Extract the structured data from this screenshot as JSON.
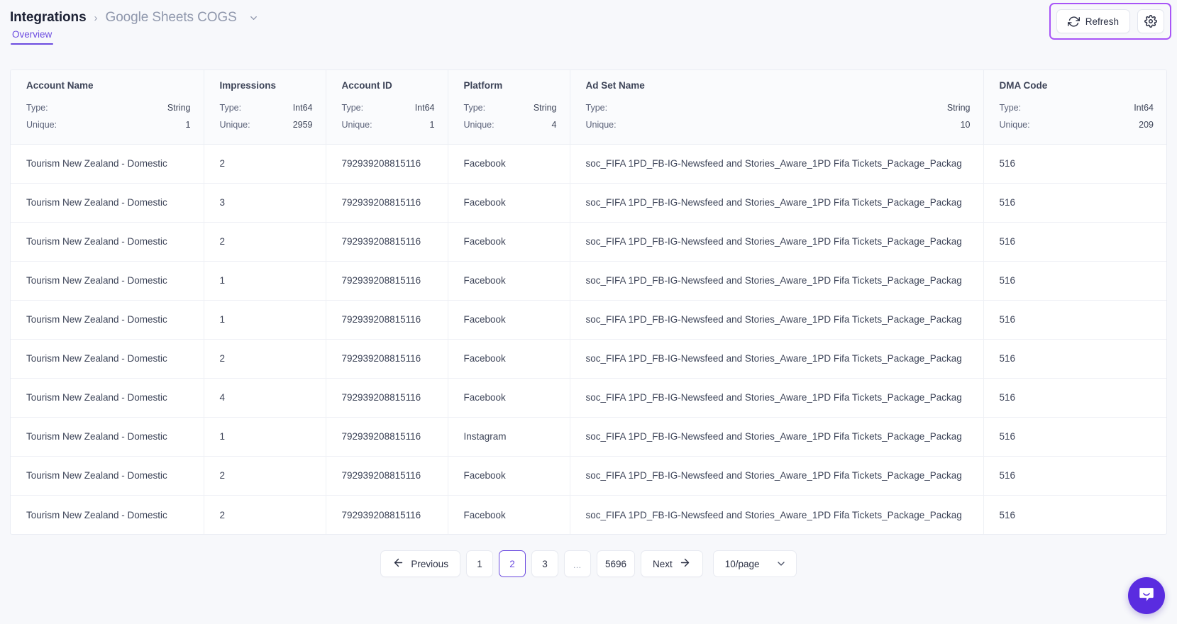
{
  "header": {
    "breadcrumb_root": "Integrations",
    "breadcrumb_separator": "›",
    "breadcrumb_current": "Google Sheets COGS",
    "tabs": [
      {
        "label": "Overview",
        "active": true
      }
    ],
    "actions": {
      "refresh_label": "Refresh",
      "refresh_icon": "refresh-icon",
      "settings_icon": "gear-icon",
      "highlight_color": "#a855f7"
    }
  },
  "accent_color": "#6c4ce0",
  "table": {
    "meta_labels": {
      "type": "Type:",
      "unique": "Unique:"
    },
    "columns": [
      {
        "name": "Account Name",
        "type": "String",
        "unique": "1"
      },
      {
        "name": "Impressions",
        "type": "Int64",
        "unique": "2959"
      },
      {
        "name": "Account ID",
        "type": "Int64",
        "unique": "1"
      },
      {
        "name": "Platform",
        "type": "String",
        "unique": "4"
      },
      {
        "name": "Ad Set Name",
        "type": "String",
        "unique": "10"
      },
      {
        "name": "DMA Code",
        "type": "Int64",
        "unique": "209"
      }
    ],
    "rows": [
      {
        "account_name": "Tourism New Zealand - Domestic",
        "impressions": "2",
        "account_id": "792939208815116",
        "platform": "Facebook",
        "ad_set_name": "soc_FIFA 1PD_FB-IG-Newsfeed and Stories_Aware_1PD Fifa Tickets_Package_Packag",
        "dma_code": "516"
      },
      {
        "account_name": "Tourism New Zealand - Domestic",
        "impressions": "3",
        "account_id": "792939208815116",
        "platform": "Facebook",
        "ad_set_name": "soc_FIFA 1PD_FB-IG-Newsfeed and Stories_Aware_1PD Fifa Tickets_Package_Packag",
        "dma_code": "516"
      },
      {
        "account_name": "Tourism New Zealand - Domestic",
        "impressions": "2",
        "account_id": "792939208815116",
        "platform": "Facebook",
        "ad_set_name": "soc_FIFA 1PD_FB-IG-Newsfeed and Stories_Aware_1PD Fifa Tickets_Package_Packag",
        "dma_code": "516"
      },
      {
        "account_name": "Tourism New Zealand - Domestic",
        "impressions": "1",
        "account_id": "792939208815116",
        "platform": "Facebook",
        "ad_set_name": "soc_FIFA 1PD_FB-IG-Newsfeed and Stories_Aware_1PD Fifa Tickets_Package_Packag",
        "dma_code": "516"
      },
      {
        "account_name": "Tourism New Zealand - Domestic",
        "impressions": "1",
        "account_id": "792939208815116",
        "platform": "Facebook",
        "ad_set_name": "soc_FIFA 1PD_FB-IG-Newsfeed and Stories_Aware_1PD Fifa Tickets_Package_Packag",
        "dma_code": "516"
      },
      {
        "account_name": "Tourism New Zealand - Domestic",
        "impressions": "2",
        "account_id": "792939208815116",
        "platform": "Facebook",
        "ad_set_name": "soc_FIFA 1PD_FB-IG-Newsfeed and Stories_Aware_1PD Fifa Tickets_Package_Packag",
        "dma_code": "516"
      },
      {
        "account_name": "Tourism New Zealand - Domestic",
        "impressions": "4",
        "account_id": "792939208815116",
        "platform": "Facebook",
        "ad_set_name": "soc_FIFA 1PD_FB-IG-Newsfeed and Stories_Aware_1PD Fifa Tickets_Package_Packag",
        "dma_code": "516"
      },
      {
        "account_name": "Tourism New Zealand - Domestic",
        "impressions": "1",
        "account_id": "792939208815116",
        "platform": "Instagram",
        "ad_set_name": "soc_FIFA 1PD_FB-IG-Newsfeed and Stories_Aware_1PD Fifa Tickets_Package_Packag",
        "dma_code": "516"
      },
      {
        "account_name": "Tourism New Zealand - Domestic",
        "impressions": "2",
        "account_id": "792939208815116",
        "platform": "Facebook",
        "ad_set_name": "soc_FIFA 1PD_FB-IG-Newsfeed and Stories_Aware_1PD Fifa Tickets_Package_Packag",
        "dma_code": "516"
      },
      {
        "account_name": "Tourism New Zealand - Domestic",
        "impressions": "2",
        "account_id": "792939208815116",
        "platform": "Facebook",
        "ad_set_name": "soc_FIFA 1PD_FB-IG-Newsfeed and Stories_Aware_1PD Fifa Tickets_Package_Packag",
        "dma_code": "516"
      }
    ]
  },
  "pagination": {
    "previous_label": "Previous",
    "next_label": "Next",
    "pages": [
      "1",
      "2",
      "3",
      "…",
      "5696"
    ],
    "active_page": "2",
    "page_size_label": "10/page"
  },
  "chat": {
    "icon": "chat-bubble-icon",
    "color": "#5a2ce0"
  }
}
